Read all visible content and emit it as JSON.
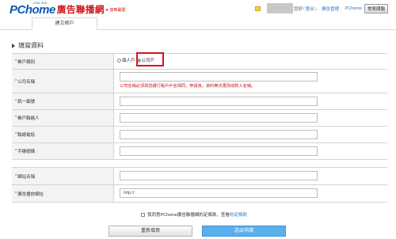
{
  "header": {
    "logo_main": "PChome",
    "logo_online": "ONLINE",
    "logo_cn": "廣告聯播網",
    "badge": "加到最愛",
    "nav": {
      "user_suffix": "您好",
      "logout": "登出",
      "ad_manager": "廣告管理",
      "pchome": "PChome",
      "common_button": "常見問題"
    }
  },
  "tabs": [
    {
      "label": "建立帳戶"
    }
  ],
  "section_title": "填寫資料",
  "form": {
    "account_type": {
      "label": "帳戶類別",
      "options": [
        "個人戶",
        "公司戶"
      ],
      "selected": "公司戶"
    },
    "company_name": {
      "label": "公司名稱",
      "value": "",
      "hint": "公司名稱必須與您銀行帳戶戶名相同，申請後，資料無法更改收款人名稱。"
    },
    "tax_id": {
      "label": "統一編號",
      "value": ""
    },
    "contact": {
      "label": "帳戶聯絡人",
      "value": ""
    },
    "phone": {
      "label": "聯絡電話",
      "value": ""
    },
    "mobile": {
      "label": "手機號碼",
      "value": ""
    },
    "site_name": {
      "label": "網站名稱",
      "value": ""
    },
    "ad_url": {
      "label": "廣告播放網址",
      "value": "http://"
    }
  },
  "agreement": {
    "text": "我同意PChome廣告聯播網約定條款，查看",
    "link": "約定條款"
  },
  "buttons": {
    "reset": "重新填寫",
    "submit": "送出申請"
  }
}
